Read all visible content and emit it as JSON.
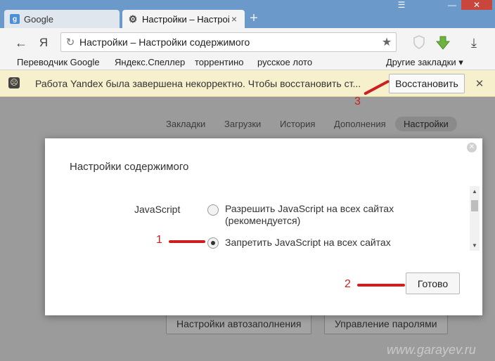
{
  "tabs": [
    {
      "label": "Google",
      "icon": "google-favicon"
    },
    {
      "label": "Настройки – Настрой",
      "icon": "gear-icon"
    }
  ],
  "tab_close_glyph": "×",
  "new_tab_glyph": "+",
  "toolbar": {
    "back_glyph": "←",
    "yandex_glyph": "Я",
    "reload_glyph": "↻",
    "address": "Настройки – Настройки содержимого",
    "star_glyph": "★",
    "download_glyph": "⤓"
  },
  "bookmarks": [
    "Переводчик Google",
    "Яндекс.Спеллер",
    "торрентино",
    "русское лото"
  ],
  "other_bookmarks": "Другие закладки ▾",
  "infobar": {
    "message": "Работа Yandex была завершена некорректно. Чтобы восстановить ст...",
    "button": "Восстановить",
    "close_glyph": "✕"
  },
  "settings_nav": [
    "Закладки",
    "Загрузки",
    "История",
    "Дополнения",
    "Настройки"
  ],
  "background_buttons": [
    "Настройки автозаполнения",
    "Управление паролями"
  ],
  "dialog": {
    "title": "Настройки содержимого",
    "section_label": "JavaScript",
    "options": [
      {
        "line1": "Разрешить JavaScript на всех сайтах",
        "line2": "(рекомендуется)",
        "selected": false
      },
      {
        "line1": "Запретить JavaScript на всех сайтах",
        "line2": "",
        "selected": true
      }
    ],
    "done_button": "Готово"
  },
  "annotations": [
    "1",
    "2",
    "3"
  ],
  "watermark": "www.garayev.ru",
  "colors": {
    "tabstrip": "#6b99c9",
    "infobar": "#f7f0cc",
    "annotation": "#cc1f1f"
  }
}
